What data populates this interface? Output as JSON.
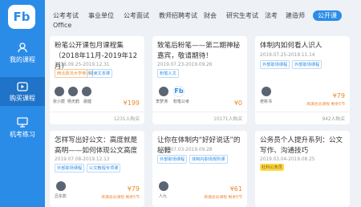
{
  "sidebar": {
    "logo": "Fb",
    "items": [
      {
        "label": "我的课程",
        "icon": "user-icon"
      },
      {
        "label": "购买课程",
        "icon": "video-icon"
      },
      {
        "label": "机考练习",
        "icon": "monitor-icon"
      }
    ],
    "active_index": 1,
    "accent": "#2b8ce8"
  },
  "tabs": [
    "公考考试",
    "事业单位",
    "公考面试",
    "教师招聘考试",
    "财会",
    "研究生考试",
    "法考",
    "建造师",
    "公开课",
    "Office"
  ],
  "active_tab": "公开课",
  "cards": [
    {
      "title": "粉笔公开课包月课程集（2018年11月-2019年12月）",
      "date": "2018.09.25-2019.12.31",
      "tags": [
        "西北政法大学考研",
        "阅读文本课"
      ],
      "teachers": [
        "张小宸",
        "杨天鹤",
        "晨健"
      ],
      "price": "¥199",
      "buyers": "1231人购买"
    },
    {
      "title": "致笔后粉笔——第二期神秘嘉宾，敬请期待！",
      "date": "2019.07.23-2019.09.26",
      "tags": [
        "粉笔人文"
      ],
      "teachers": [
        "李梦涛",
        "粉笔公考"
      ],
      "price": "¥0",
      "buyers": "10171人购买"
    },
    {
      "title": "体制内如何看人识人",
      "date": "2019.07.25-2019.11.14",
      "tags": [
        "外部职场课程",
        "外部职场课程"
      ],
      "teachers": [
        "老彬书"
      ],
      "price": "¥79",
      "stock": "库满会员课程 剩余5节",
      "buyers": "942人购买"
    },
    {
      "title": "怎样写出好公文：高度就是高明——如何体现公文高度",
      "date": "2019.07.08-2019.12.13",
      "tags": [
        "外部职场课程",
        "公文教程专项课"
      ],
      "teachers": [
        "吕东影"
      ],
      "price": "¥79",
      "stock": "库满会员课程 剩余5节",
      "buyers": ""
    },
    {
      "title": "让你在体制内“好好说话”的秘籍",
      "date": "2019.07.03-2019.09.28",
      "tags": [
        "外部职场课程",
        "体制内职场规则课"
      ],
      "teachers": [
        "人九"
      ],
      "price": "¥61",
      "stock": "库满会员课程 剩余5节",
      "buyers": ""
    },
    {
      "title": "公务员个人提升系列：公文写作、沟通技巧",
      "date": "2019.03.04-2019.08.25",
      "tags": [
        "社科公务员"
      ],
      "teachers": [],
      "price": "",
      "buyers": ""
    }
  ]
}
